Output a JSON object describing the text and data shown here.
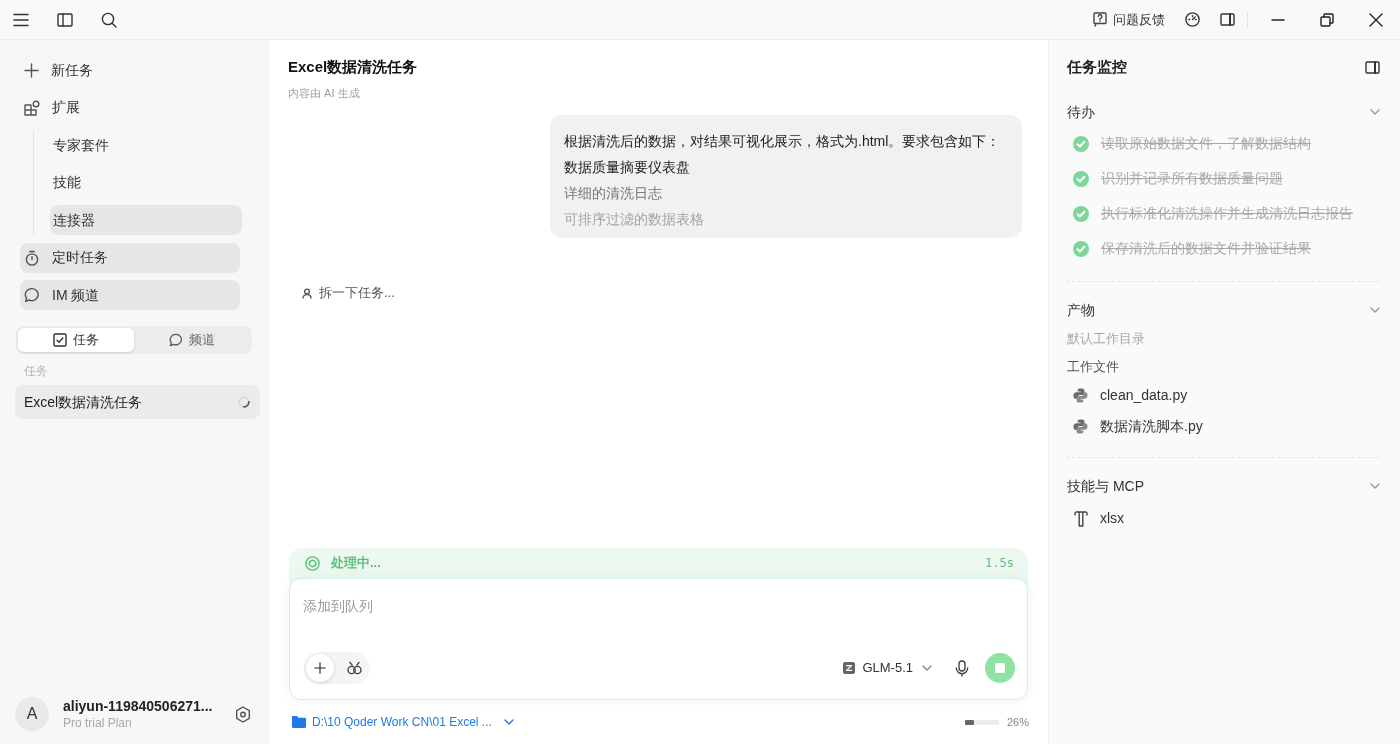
{
  "title_bar": {
    "feedback_label": "问题反馈"
  },
  "sidebar": {
    "items": [
      {
        "label": "新任务",
        "highlighted": false
      },
      {
        "label": "扩展",
        "highlighted": false,
        "children": [
          {
            "label": "专家套件",
            "highlighted": false
          },
          {
            "label": "技能",
            "highlighted": false
          },
          {
            "label": "连接器",
            "highlighted": true
          }
        ]
      },
      {
        "label": "定时任务",
        "highlighted": true
      },
      {
        "label": "IM 频道",
        "highlighted": true
      }
    ],
    "tabs": [
      {
        "label": "任务",
        "selected": true
      },
      {
        "label": "频道",
        "selected": false
      }
    ],
    "section_label": "任务",
    "tasks": [
      {
        "title": "Excel数据清洗任务",
        "selected": true,
        "running": true
      }
    ],
    "user": {
      "avatar_letter": "A",
      "name": "aliyun-119840506271...",
      "plan": "Pro trial Plan"
    }
  },
  "main": {
    "title": "Excel数据清洗任务",
    "subtitle": "内容由 AI 生成",
    "message": {
      "collapsed": true,
      "lines": [
        "根据清洗后的数据，对结果可视化展示，格式为.html。要求包含如下：",
        "数据质量摘要仪表盘",
        "详细的清洗日志",
        "可排序过滤的数据表格"
      ]
    },
    "thinking": "拆一下任务...",
    "status": {
      "label": "处理中...",
      "time": "1.5s"
    },
    "composer": {
      "placeholder": "添加到队列",
      "model": "GLM-5.1"
    },
    "workspace": {
      "path": "D:\\10 Qoder Work CN\\01 Excel ...",
      "context": {
        "level": 0.26,
        "reading": "26%"
      }
    }
  },
  "task_monitor": {
    "title": "任务监控",
    "sections": [
      {
        "kind": "todo",
        "title": "待办",
        "expanded": true,
        "items": [
          {
            "label": "读取原始数据文件，了解数据结构",
            "done": true
          },
          {
            "label": "识别并记录所有数据质量问题",
            "done": true
          },
          {
            "label": "执行标准化清洗操作并生成清洗日志报告",
            "done": true
          },
          {
            "label": "保存清洗后的数据文件并验证结果",
            "done": true
          }
        ]
      },
      {
        "kind": "artifacts",
        "title": "产物",
        "expanded": true,
        "directory": "默认工作目录",
        "group_label": "工作文件",
        "files": [
          "clean_data.py",
          "数据清洗脚本.py"
        ]
      },
      {
        "kind": "skills",
        "title": "技能与 MCP",
        "expanded": true,
        "items": [
          "xlsx"
        ]
      }
    ]
  }
}
